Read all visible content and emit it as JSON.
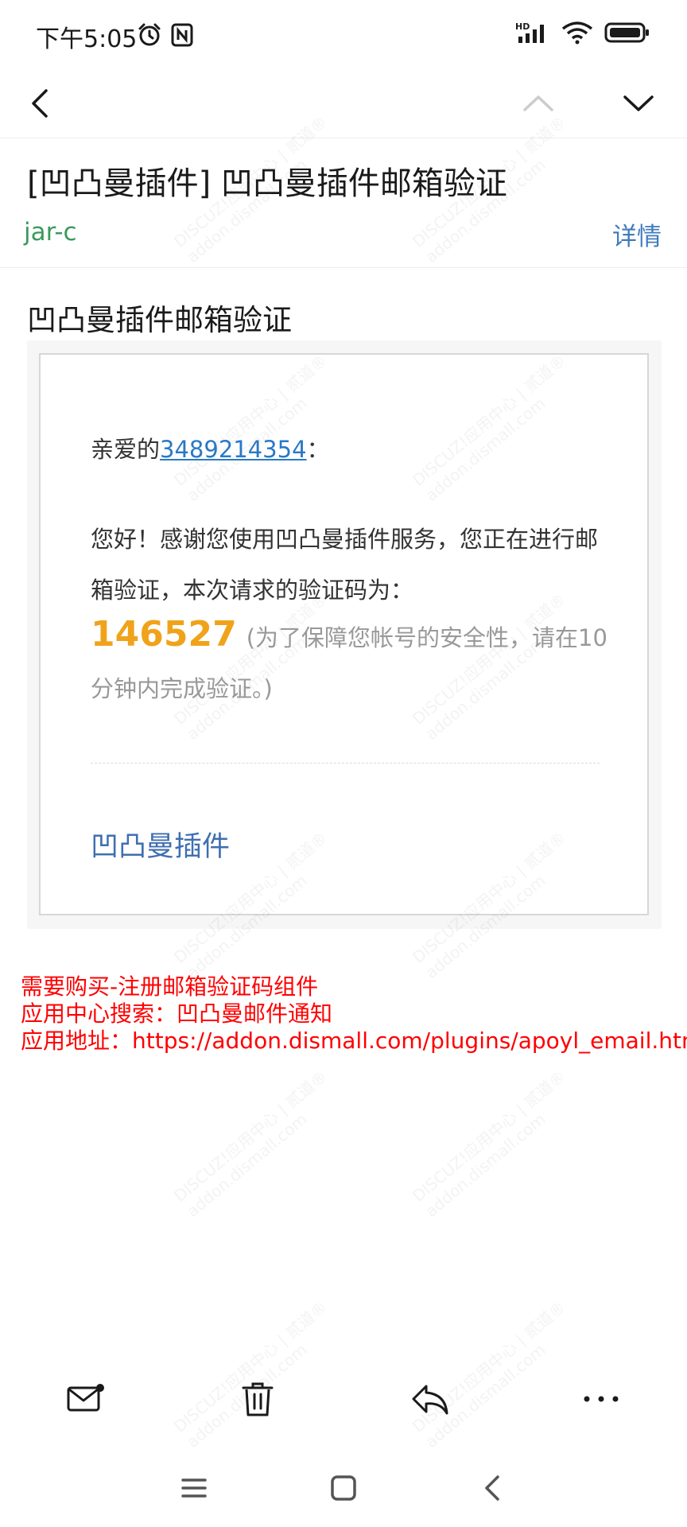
{
  "status_bar": {
    "time": "下午5:05",
    "icons": [
      "alarm-icon",
      "nfc-icon",
      "signal-icon",
      "wifi-icon",
      "battery-icon"
    ]
  },
  "nav": {
    "icons": [
      "back-icon",
      "previous-mail-icon",
      "next-mail-icon"
    ]
  },
  "mail": {
    "subject": "[凹凸曼插件] 凹凸曼插件邮箱验证",
    "sender": "jar-c",
    "details_label": "详情",
    "heading": "凹凸曼插件邮箱验证",
    "greeting_prefix": "亲爱的",
    "username": "3489214354",
    "greeting_suffix": "：",
    "paragraph": "您好！感谢您使用凹凸曼插件服务，您正在进行邮箱验证，本次请求的验证码为：",
    "code": "146527",
    "code_note": "(为了保障您帐号的安全性，请在10分钟内完成验证。)",
    "signature": "凹凸曼插件"
  },
  "note": {
    "line1": "需要购买-注册邮箱验证码组件",
    "line2": "应用中心搜索：凹凸曼邮件通知",
    "line3": "应用地址：https://addon.dismall.com/plugins/apoyl_email.html"
  },
  "watermark": {
    "text1": "DISCUZ!应用中心 | 贰道®",
    "text2": "addon.dismall.com"
  },
  "toolbar": {
    "icons": [
      "mark-unread-icon",
      "delete-icon",
      "reply-icon",
      "more-icon"
    ]
  },
  "system_nav": {
    "icons": [
      "menu-icon",
      "home-icon",
      "back-icon"
    ]
  },
  "colors": {
    "sender": "#3a9a5c",
    "link": "#2a78c6",
    "details": "#3f7bbf",
    "code": "#f0a31a",
    "signature": "#3f6fb0",
    "note": "#ff0000"
  }
}
